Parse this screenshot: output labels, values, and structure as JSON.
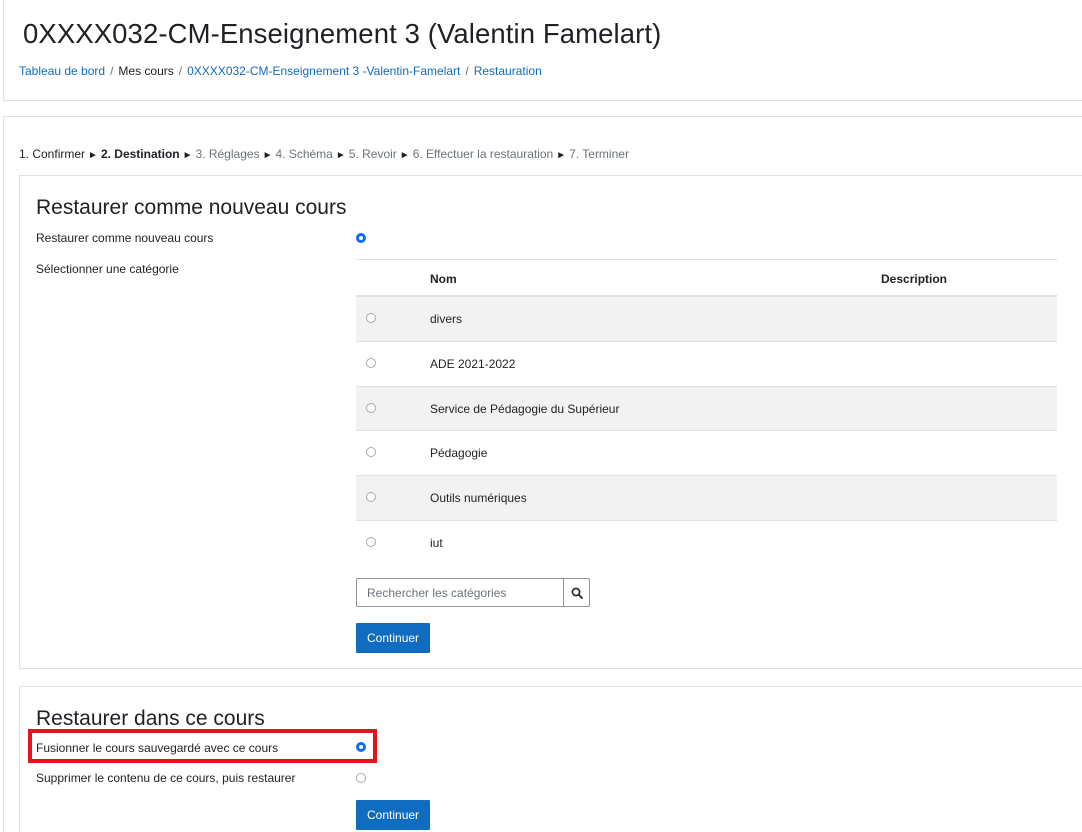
{
  "header": {
    "title": "0XXXX032-CM-Enseignement 3 (Valentin Famelart)",
    "breadcrumb": [
      "Tableau de bord",
      "Mes cours",
      "0XXXX032-CM-Enseignement 3 -Valentin-Famelart",
      "Restauration"
    ]
  },
  "steps": {
    "s1": "1. Confirmer",
    "s2": "2. Destination",
    "s3": "3. Réglages",
    "s4": "4. Schéma",
    "s5": "5. Revoir",
    "s6": "6. Effectuer la restauration",
    "s7": "7. Terminer",
    "arrow": "►"
  },
  "new_course": {
    "title": "Restaurer comme nouveau cours",
    "option_label": "Restaurer comme nouveau cours",
    "category_label": "Sélectionner une catégorie",
    "table": {
      "col_name": "Nom",
      "col_desc": "Description",
      "rows": [
        "divers",
        "ADE 2021-2022",
        "Service de Pédagogie du Supérieur",
        "Pédagogie",
        "Outils numériques",
        "iut"
      ]
    },
    "search_placeholder": "Rechercher les catégories",
    "continue_label": "Continuer"
  },
  "this_course": {
    "title": "Restaurer dans ce cours",
    "merge_label": "Fusionner le cours sauvegardé avec ce cours",
    "delete_label": "Supprimer le contenu de ce cours, puis restaurer",
    "continue_label": "Continuer"
  },
  "colors": {
    "link": "#0f6cbf",
    "primary_button": "#0f6cbf",
    "radio_checked": "#0f6cfb",
    "highlight": "#e3141b"
  }
}
